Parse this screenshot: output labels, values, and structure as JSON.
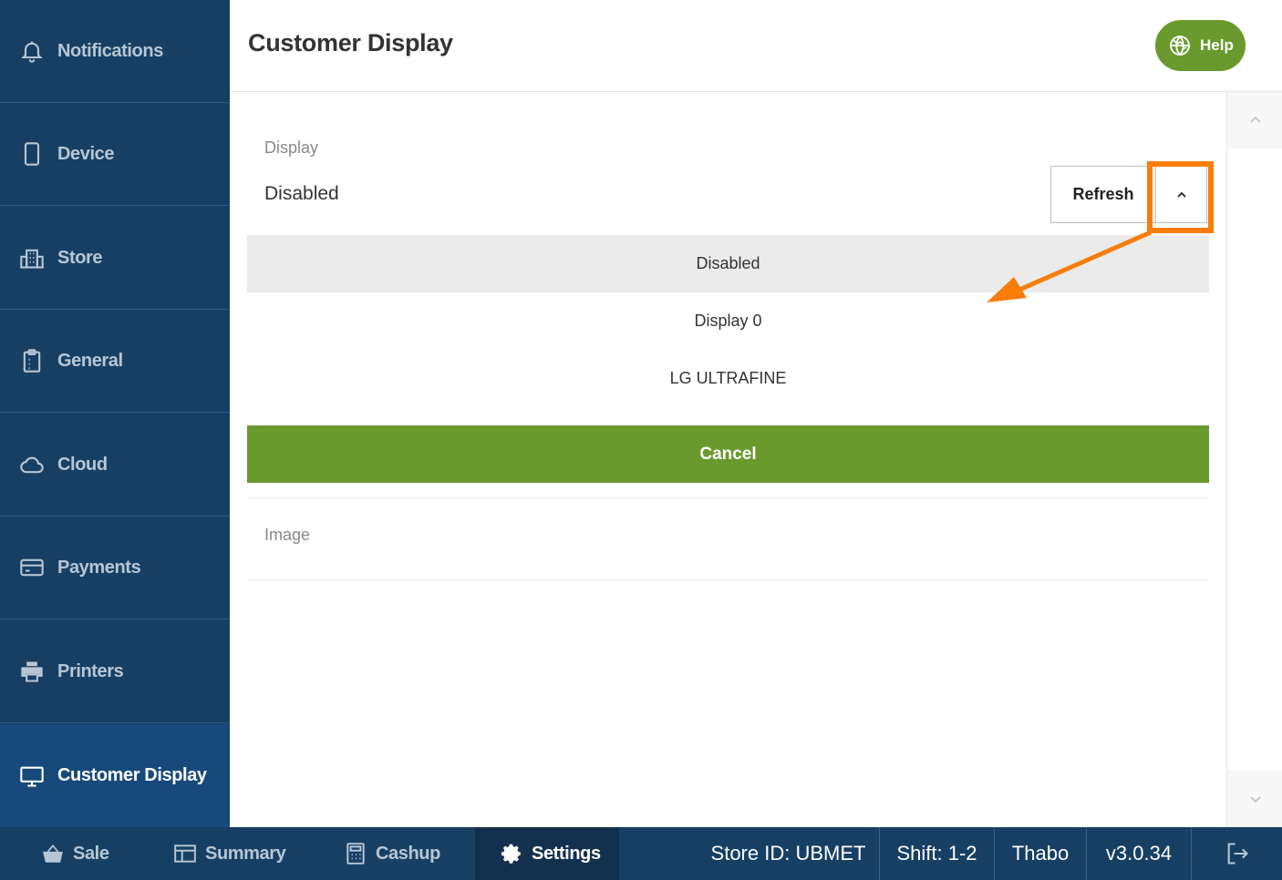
{
  "sidebar": {
    "items": [
      {
        "label": "Notifications",
        "icon": "bell-icon"
      },
      {
        "label": "Device",
        "icon": "device-icon"
      },
      {
        "label": "Store",
        "icon": "store-icon"
      },
      {
        "label": "General",
        "icon": "clipboard-icon"
      },
      {
        "label": "Cloud",
        "icon": "cloud-icon"
      },
      {
        "label": "Payments",
        "icon": "credit-card-icon"
      },
      {
        "label": "Printers",
        "icon": "printer-icon"
      },
      {
        "label": "Customer Display",
        "icon": "monitor-icon",
        "active": true
      }
    ]
  },
  "header": {
    "title": "Customer Display",
    "help_label": "Help"
  },
  "display_setting": {
    "label": "Display",
    "value": "Disabled",
    "refresh_label": "Refresh",
    "options": [
      "Disabled",
      "Display 0",
      "LG ULTRAFINE"
    ],
    "selected_option": "Disabled",
    "cancel_label": "Cancel"
  },
  "image_setting": {
    "label": "Image"
  },
  "bottom_bar": {
    "tabs": [
      {
        "label": "Sale",
        "icon": "basket-icon"
      },
      {
        "label": "Summary",
        "icon": "table-icon"
      },
      {
        "label": "Cashup",
        "icon": "calculator-icon"
      },
      {
        "label": "Settings",
        "icon": "gear-icon",
        "active": true
      }
    ],
    "store_id": "Store ID: UBMET",
    "shift": "Shift: 1-2",
    "user": "Thabo",
    "version": "v3.0.34"
  },
  "colors": {
    "sidebar_bg": "#173f63",
    "sidebar_active": "#17497a",
    "accent_green": "#6a9a2d",
    "annotation_orange": "#f97d0b"
  }
}
